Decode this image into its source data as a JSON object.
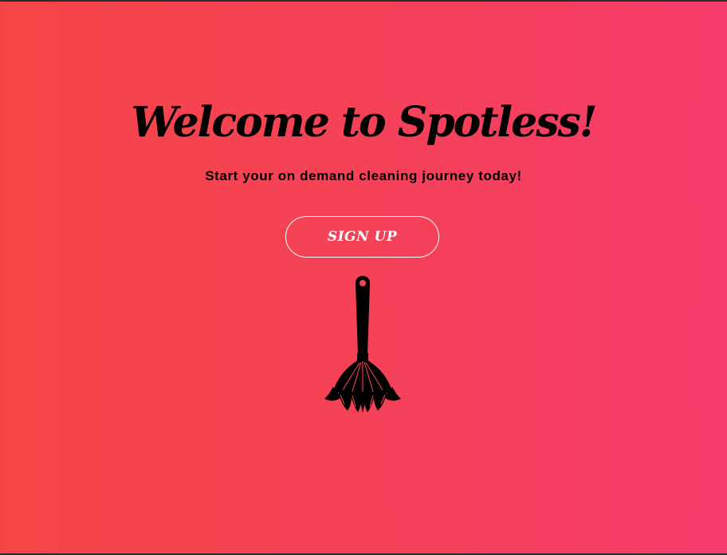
{
  "hero": {
    "title": "Welcome to Spotless!",
    "subtitle": "Start your on demand cleaning journey today!",
    "signup_label": "SIGN UP",
    "illustration_icon": "feather-duster-icon"
  },
  "colors": {
    "gradient_start": "#f54647",
    "gradient_end": "#f53b6b",
    "text": "#000000",
    "button_text": "#ffffff"
  }
}
